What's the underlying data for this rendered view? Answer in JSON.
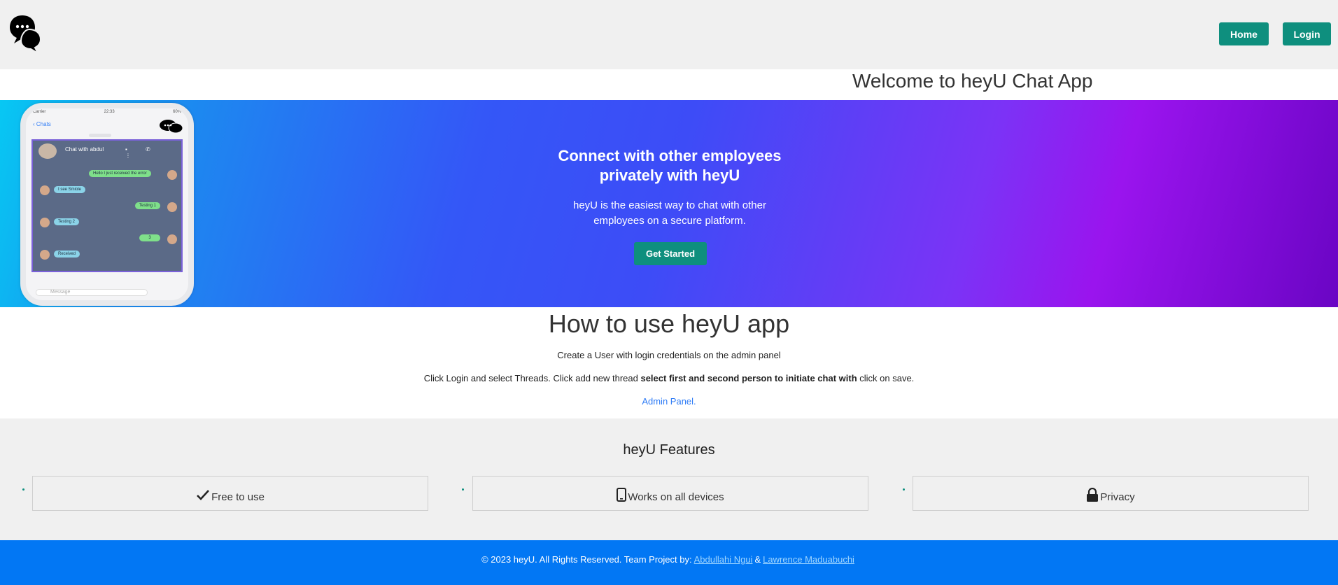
{
  "header": {
    "logo_icon": "chat-bubbles-icon",
    "nav": {
      "home_label": "Home",
      "login_label": "Login"
    }
  },
  "welcome": {
    "title": "Welcome to heyU Chat App"
  },
  "hero": {
    "title": "Connect with other employees privately with heyU",
    "text": "heyU is the easiest way to chat with other employees on a secure platform.",
    "cta_label": "Get Started",
    "phone": {
      "carrier": "Carrier",
      "time": "22:33",
      "battery": "60%",
      "back_label": "Chats",
      "chat_title": "Chat with abdul",
      "messages": [
        {
          "text": "Hello I just received the error",
          "side": "right"
        },
        {
          "text": "I see Smiole",
          "side": "left"
        },
        {
          "text": "Testing 1",
          "side": "right"
        },
        {
          "text": "Testing 2",
          "side": "left"
        },
        {
          "text": "3",
          "side": "right"
        },
        {
          "text": "Received",
          "side": "left"
        }
      ],
      "input_placeholder": "Message"
    }
  },
  "howto": {
    "title": "How to use heyU app",
    "line1": "Create a User with login credentials on the admin panel",
    "line2_pre": "Click Login and select Threads. Click add new thread ",
    "line2_bold": "select first and second person to initiate chat with",
    "line2_post": " click on save.",
    "link": "Admin Panel."
  },
  "features": {
    "title": "heyU Features",
    "items": [
      {
        "label": "Free to use",
        "icon": "check-icon"
      },
      {
        "label": "Works on all devices",
        "icon": "mobile-icon"
      },
      {
        "label": "Privacy",
        "icon": "lock-icon"
      }
    ]
  },
  "footer": {
    "text": "© 2023 heyU. All Rights Reserved. Team Project by:",
    "author1": "Abdullahi Ngui",
    "amp": "&",
    "author2": "Lawrence Maduabuchi"
  },
  "colors": {
    "accent": "#0e8f7e",
    "footer": "#0277f4",
    "header_bg": "#f0f0f0"
  }
}
